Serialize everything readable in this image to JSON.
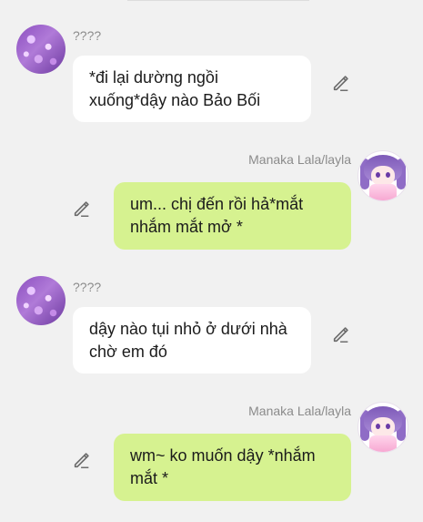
{
  "messages": [
    {
      "sender": "????",
      "side": "left",
      "avatar_icon": "sakura-avatar",
      "text": "*đi lại dường ngồi\nxuống*dậy nào Bảo Bối"
    },
    {
      "sender": "Manaka Lala/layla",
      "side": "right",
      "avatar_icon": "anime-girl-avatar",
      "text": "um... chị đến rồi hả*mắt\nnhắm mắt mở *"
    },
    {
      "sender": "????",
      "side": "left",
      "avatar_icon": "sakura-avatar",
      "text": "dậy nào tụi nhỏ ở dưới nhà\nchờ em đó"
    },
    {
      "sender": "Manaka Lala/layla",
      "side": "right",
      "avatar_icon": "anime-girl-avatar",
      "text": "wm~ ko muốn dậy *nhắm\nmắt *"
    }
  ],
  "icons": {
    "edit": "pencil-edit-icon"
  },
  "colors": {
    "background": "#f1f1f1",
    "left_bubble": "#ffffff",
    "right_bubble": "#d6f290",
    "name_text": "#8b8b8b",
    "icon": "#6b6b6b"
  }
}
